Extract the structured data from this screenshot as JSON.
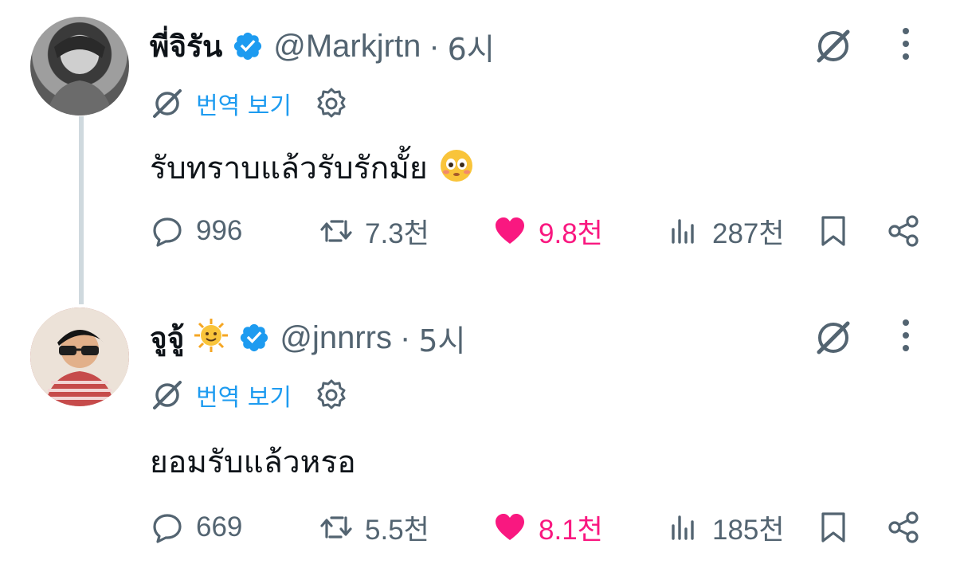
{
  "tweets": [
    {
      "display_name": "พี่จิรัน",
      "name_emoji": "",
      "handle": "@Markjrtn",
      "separator": "·",
      "time": "6시",
      "translate_label": "번역 보기",
      "text": "รับทราบแล้วรับรักมั้ย",
      "text_emoji": "😳",
      "replies": "996",
      "reposts": "7.3천",
      "likes": "9.8천",
      "views": "287천"
    },
    {
      "display_name": "จูจู้",
      "name_emoji": "🌞",
      "handle": "@jnnrrs",
      "separator": "·",
      "time": "5시",
      "translate_label": "번역 보기",
      "text": "ยอมรับแล้วหรอ",
      "text_emoji": "",
      "replies": "669",
      "reposts": "5.5천",
      "likes": "8.1천",
      "views": "185천"
    }
  ],
  "colors": {
    "verified": "#1d9bf0",
    "link": "#1d9bf0",
    "like": "#f91880",
    "muted": "#536471",
    "thread_line": "#cfd9de"
  },
  "icons": {
    "reply": "speech-bubble-icon",
    "repost": "repost-arrows-icon",
    "like": "heart-icon",
    "views": "bar-chart-icon",
    "bookmark": "bookmark-icon",
    "share": "share-nodes-icon",
    "grok": "grok-slash-icon",
    "more": "vertical-dots-icon",
    "translate": "translate-icon",
    "settings": "gear-icon",
    "verified": "verified-badge-icon"
  }
}
